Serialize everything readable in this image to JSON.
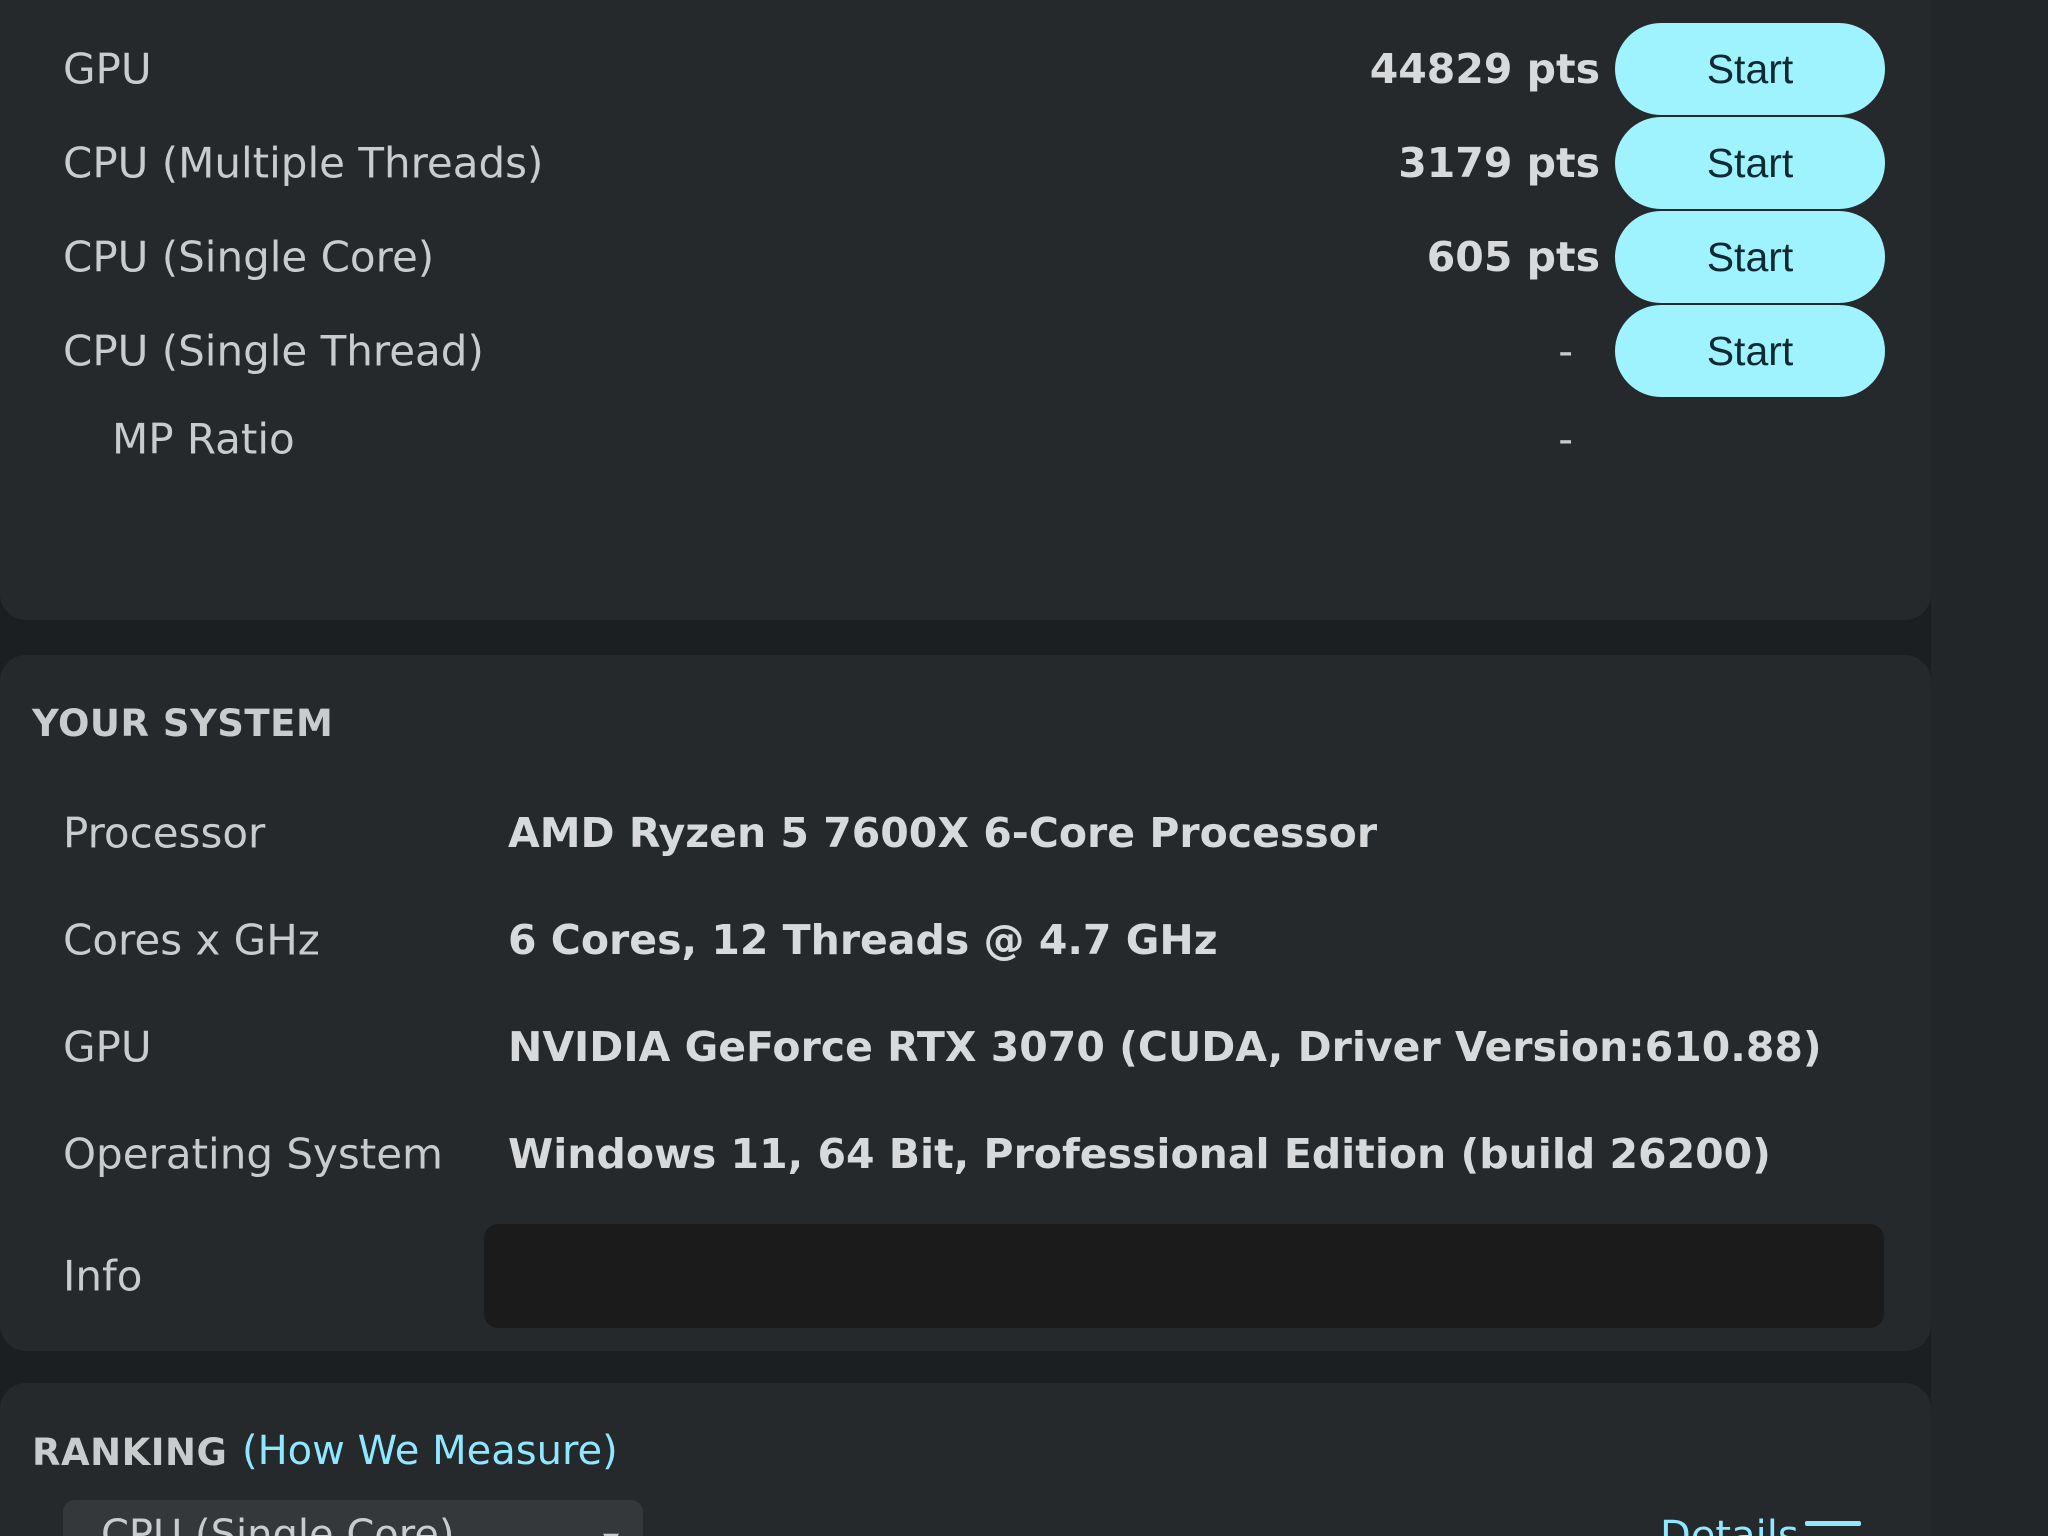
{
  "tests": [
    {
      "label": "GPU",
      "score": "44829 pts",
      "button": "Start"
    },
    {
      "label": "CPU (Multiple Threads)",
      "score": "3179 pts",
      "button": "Start"
    },
    {
      "label": "CPU (Single Core)",
      "score": "605 pts",
      "button": "Start"
    },
    {
      "label": "CPU (Single Thread)",
      "score": "-",
      "button": "Start"
    }
  ],
  "mp_ratio": {
    "label": "MP Ratio",
    "value": "-"
  },
  "system": {
    "title": "YOUR SYSTEM",
    "rows": [
      {
        "label": "Processor",
        "value": "AMD Ryzen 5 7600X 6-Core Processor"
      },
      {
        "label": "Cores x GHz",
        "value": "6 Cores, 12 Threads @ 4.7 GHz"
      },
      {
        "label": "GPU",
        "value": "NVIDIA GeForce RTX 3070 (CUDA, Driver Version:610.88)"
      },
      {
        "label": "Operating System",
        "value": "Windows 11, 64 Bit, Professional Edition (build 26200)"
      }
    ],
    "info_label": "Info",
    "info_value": ""
  },
  "ranking": {
    "title": "RANKING",
    "link": "(How We Measure)",
    "dropdown_value": "CPU (Single Core)",
    "details_label": "Details"
  },
  "colors": {
    "accent": "#9ff3ff",
    "link": "#8fe8ff",
    "panel": "#25292c",
    "background": "#1c1f21"
  }
}
